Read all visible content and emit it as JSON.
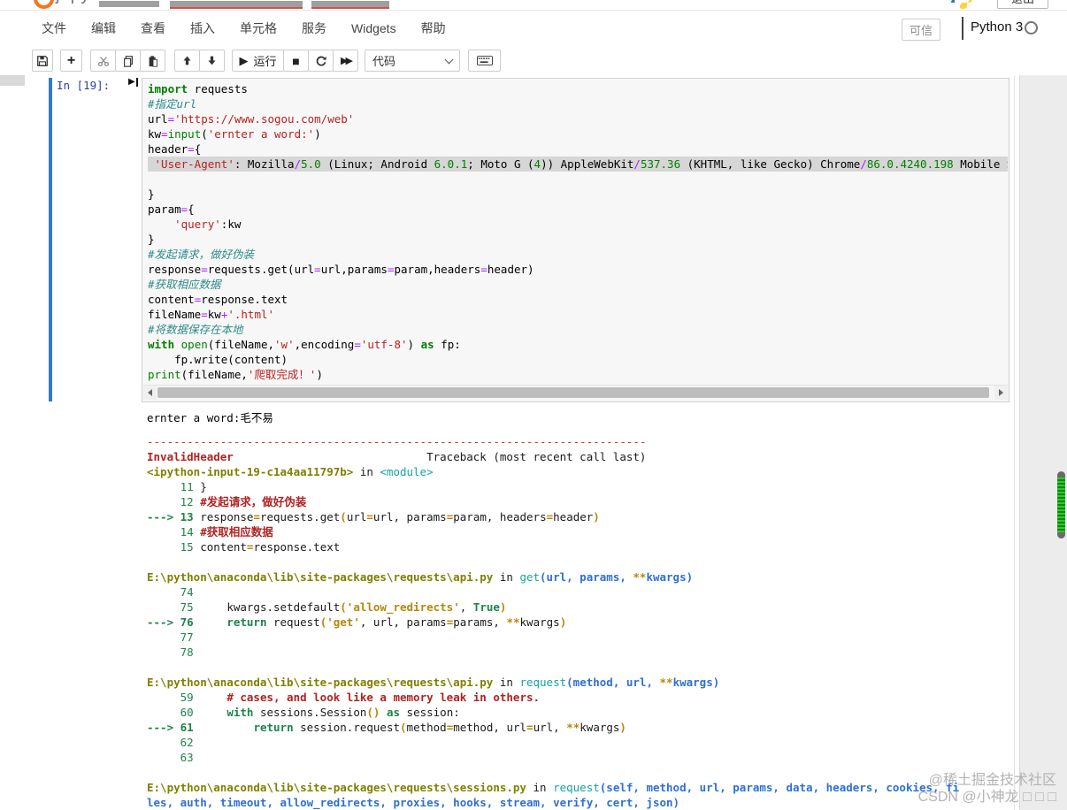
{
  "topbar": {
    "logo_text": "jupyter",
    "logout_label": "退出"
  },
  "menubar": {
    "items": [
      "文件",
      "编辑",
      "查看",
      "插入",
      "单元格",
      "服务",
      "Widgets",
      "帮助"
    ],
    "trusted_label": "可信",
    "kernel_name": "Python 3"
  },
  "toolbar": {
    "run_label": "运行",
    "cell_type_value": "代码"
  },
  "cell": {
    "prompt": "In [19]:",
    "code_lines": [
      [
        [
          "k",
          "import"
        ],
        [
          "t",
          " requests"
        ]
      ],
      [
        [
          "c",
          "#指定url"
        ]
      ],
      [
        [
          "t",
          "url"
        ],
        [
          "o",
          "="
        ],
        [
          "s",
          "'https://www.sogou.com/web'"
        ]
      ],
      [
        [
          "t",
          "kw"
        ],
        [
          "o",
          "="
        ],
        [
          "b",
          "input"
        ],
        [
          "t",
          "("
        ],
        [
          "s",
          "'ernter a word:'"
        ],
        [
          "t",
          ")"
        ]
      ],
      [
        [
          "t",
          "header"
        ],
        [
          "o",
          "="
        ],
        [
          "t",
          "{"
        ]
      ],
      {
        "sel": true,
        "tk": [
          [
            "t",
            " "
          ],
          [
            "s",
            "'User-Agent'"
          ],
          [
            "t",
            ": Mozilla"
          ],
          [
            "o",
            "/"
          ],
          [
            "n",
            "5.0"
          ],
          [
            "t",
            " (Linux; Android "
          ],
          [
            "n",
            "6.0.1"
          ],
          [
            "t",
            "; Moto G ("
          ],
          [
            "n",
            "4"
          ],
          [
            "t",
            ")) AppleWebKit"
          ],
          [
            "o",
            "/"
          ],
          [
            "n",
            "537.36"
          ],
          [
            "t",
            " (KHTML, like Gecko) Chrome"
          ],
          [
            "o",
            "/"
          ],
          [
            "n",
            "86.0.4240.198"
          ],
          [
            "t",
            " Mobile Safari,"
          ]
        ]
      },
      [],
      [
        [
          "t",
          "}"
        ]
      ],
      [
        [
          "t",
          "param"
        ],
        [
          "o",
          "="
        ],
        [
          "t",
          "{"
        ]
      ],
      [
        [
          "t",
          "    "
        ],
        [
          "s",
          "'query'"
        ],
        [
          "t",
          ":kw"
        ]
      ],
      [
        [
          "t",
          "}"
        ]
      ],
      [
        [
          "c",
          "#发起请求，做好伪装"
        ]
      ],
      [
        [
          "t",
          "response"
        ],
        [
          "o",
          "="
        ],
        [
          "t",
          "requests.get(url"
        ],
        [
          "o",
          "="
        ],
        [
          "t",
          "url,params"
        ],
        [
          "o",
          "="
        ],
        [
          "t",
          "param,headers"
        ],
        [
          "o",
          "="
        ],
        [
          "t",
          "header)"
        ]
      ],
      [
        [
          "c",
          "#获取相应数据"
        ]
      ],
      [
        [
          "t",
          "content"
        ],
        [
          "o",
          "="
        ],
        [
          "t",
          "response.text"
        ]
      ],
      [
        [
          "t",
          "fileName"
        ],
        [
          "o",
          "="
        ],
        [
          "t",
          "kw"
        ],
        [
          "o",
          "+"
        ],
        [
          "s",
          "'.html'"
        ]
      ],
      [
        [
          "c",
          "#将数据保存在本地"
        ]
      ],
      [
        [
          "k",
          "with"
        ],
        [
          "t",
          " "
        ],
        [
          "b",
          "open"
        ],
        [
          "t",
          "(fileName,"
        ],
        [
          "s",
          "'w'"
        ],
        [
          "t",
          ",encoding"
        ],
        [
          "o",
          "="
        ],
        [
          "s",
          "'utf-8'"
        ],
        [
          "t",
          ") "
        ],
        [
          "k",
          "as"
        ],
        [
          "t",
          " fp:"
        ]
      ],
      [
        [
          "t",
          "    fp.write(content)"
        ]
      ],
      [
        [
          "b",
          "print"
        ],
        [
          "t",
          "(fileName,"
        ],
        [
          "s",
          "'爬取完成！'"
        ],
        [
          "t",
          ")"
        ]
      ]
    ]
  },
  "output": {
    "stdout": "ernter a word:毛不易",
    "traceback_lines": [
      [
        [
          "r",
          "---------------------------------------------------------------------------"
        ]
      ],
      [
        [
          "rb",
          "InvalidHeader"
        ],
        [
          "t",
          "                             Traceback (most recent call last)"
        ]
      ],
      [
        [
          "ol",
          "<ipython-input-19-c1a4aa11797b>"
        ],
        [
          "t",
          " in "
        ],
        [
          "cy",
          "<module>"
        ]
      ],
      [
        [
          "g",
          "     11 "
        ],
        [
          "t",
          "}"
        ]
      ],
      [
        [
          "g",
          "     12 "
        ],
        [
          "rb",
          "#发起请求，做好伪装"
        ]
      ],
      [
        [
          "gb",
          "---> 13 "
        ],
        [
          "t",
          "response"
        ],
        [
          "y",
          "="
        ],
        [
          "t",
          "requests.get"
        ],
        [
          "y",
          "("
        ],
        [
          "t",
          "url"
        ],
        [
          "y",
          "="
        ],
        [
          "t",
          "url, params"
        ],
        [
          "y",
          "="
        ],
        [
          "t",
          "param, headers"
        ],
        [
          "y",
          "="
        ],
        [
          "t",
          "header"
        ],
        [
          "y",
          ")"
        ]
      ],
      [
        [
          "g",
          "     14 "
        ],
        [
          "rb",
          "#获取相应数据"
        ]
      ],
      [
        [
          "g",
          "     15 "
        ],
        [
          "t",
          "content"
        ],
        [
          "y",
          "="
        ],
        [
          "t",
          "response.text"
        ]
      ],
      [],
      [
        [
          "ol",
          "E:\\python\\anaconda\\lib\\site-packages\\requests\\api.py"
        ],
        [
          "t",
          " in "
        ],
        [
          "cy",
          "get"
        ],
        [
          "bl",
          "(url, params, "
        ],
        [
          "y",
          "**"
        ],
        [
          "bl",
          "kwargs)"
        ]
      ],
      [
        [
          "g",
          "     74 "
        ]
      ],
      [
        [
          "g",
          "     75 "
        ],
        [
          "t",
          "    kwargs.setdefault"
        ],
        [
          "y",
          "("
        ],
        [
          "y",
          "'allow_redirects'"
        ],
        [
          "t",
          ", "
        ],
        [
          "gb",
          "True"
        ],
        [
          "y",
          ")"
        ]
      ],
      [
        [
          "gb",
          "---> 76 "
        ],
        [
          "t",
          "    "
        ],
        [
          "gb",
          "return"
        ],
        [
          "t",
          " request"
        ],
        [
          "y",
          "("
        ],
        [
          "y",
          "'get'"
        ],
        [
          "t",
          ", url, params"
        ],
        [
          "y",
          "="
        ],
        [
          "t",
          "params, "
        ],
        [
          "y",
          "**"
        ],
        [
          "t",
          "kwargs"
        ],
        [
          "y",
          ")"
        ]
      ],
      [
        [
          "g",
          "     77 "
        ]
      ],
      [
        [
          "g",
          "     78 "
        ]
      ],
      [],
      [
        [
          "ol",
          "E:\\python\\anaconda\\lib\\site-packages\\requests\\api.py"
        ],
        [
          "t",
          " in "
        ],
        [
          "cy",
          "request"
        ],
        [
          "bl",
          "(method, url, "
        ],
        [
          "y",
          "**"
        ],
        [
          "bl",
          "kwargs)"
        ]
      ],
      [
        [
          "g",
          "     59 "
        ],
        [
          "rb",
          "    # cases, and look like a memory leak in others."
        ]
      ],
      [
        [
          "g",
          "     60 "
        ],
        [
          "t",
          "    "
        ],
        [
          "gb",
          "with"
        ],
        [
          "t",
          " sessions.Session"
        ],
        [
          "y",
          "()"
        ],
        [
          "t",
          " "
        ],
        [
          "gb",
          "as"
        ],
        [
          "t",
          " session:"
        ]
      ],
      [
        [
          "gb",
          "---> 61 "
        ],
        [
          "t",
          "        "
        ],
        [
          "gb",
          "return"
        ],
        [
          "t",
          " session.request"
        ],
        [
          "y",
          "("
        ],
        [
          "t",
          "method"
        ],
        [
          "y",
          "="
        ],
        [
          "t",
          "method, url"
        ],
        [
          "y",
          "="
        ],
        [
          "t",
          "url, "
        ],
        [
          "y",
          "**"
        ],
        [
          "t",
          "kwargs"
        ],
        [
          "y",
          ")"
        ]
      ],
      [
        [
          "g",
          "     62 "
        ]
      ],
      [
        [
          "g",
          "     63 "
        ]
      ],
      [],
      [
        [
          "ol",
          "E:\\python\\anaconda\\lib\\site-packages\\requests\\sessions.py"
        ],
        [
          "t",
          " in "
        ],
        [
          "cy",
          "request"
        ],
        [
          "bl",
          "(self, method, url, params, data, headers, cookies, fi"
        ]
      ],
      [
        [
          "bl",
          "les, auth, timeout, allow_redirects, proxies, hooks, stream, verify, cert, json)"
        ]
      ]
    ]
  },
  "watermark": {
    "line1": "@稀土掘金技术社区",
    "line2": "CSDN @小神龙 □ □ □"
  },
  "colors": {
    "jupyter_orange": "#f37626",
    "selected_cell_blue": "#2e7bcf",
    "error_red": "#c0392b",
    "scroll_green": "#2ec82e"
  }
}
